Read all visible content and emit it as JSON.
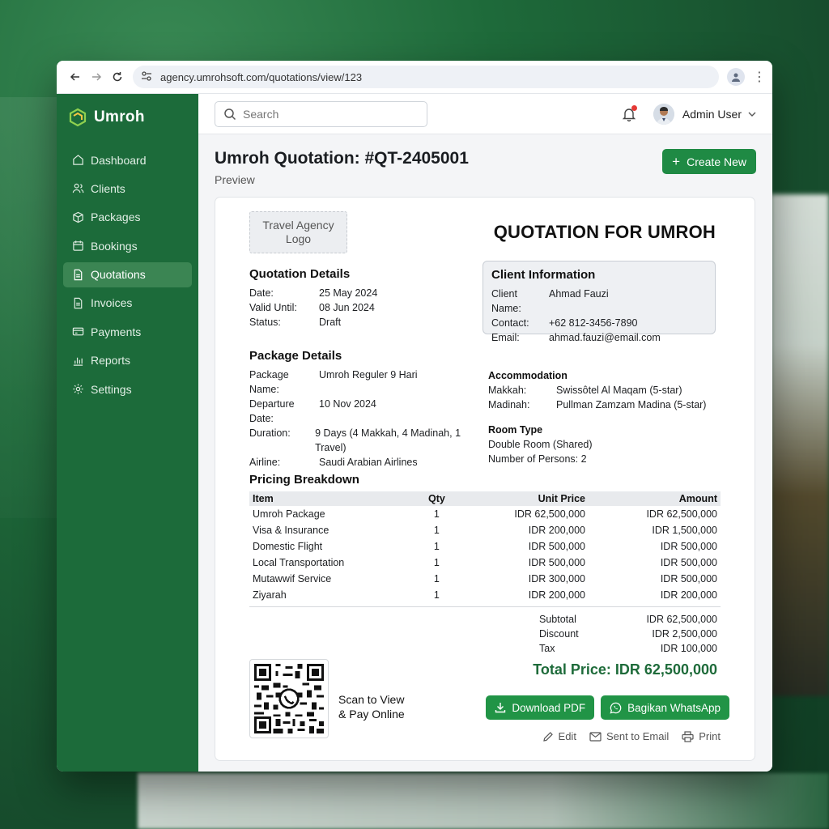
{
  "browser": {
    "url": "agency.umrohsoft.com/quotations/view/123"
  },
  "sidebar": {
    "brand": "Umroh",
    "items": [
      {
        "label": "Dashboard",
        "icon": "home-icon"
      },
      {
        "label": "Clients",
        "icon": "users-icon"
      },
      {
        "label": "Packages",
        "icon": "box-icon"
      },
      {
        "label": "Bookings",
        "icon": "calendar-icon"
      },
      {
        "label": "Quotations",
        "icon": "file-icon",
        "active": true
      },
      {
        "label": "Invoices",
        "icon": "file-icon"
      },
      {
        "label": "Payments",
        "icon": "card-icon"
      },
      {
        "label": "Reports",
        "icon": "chart-icon"
      },
      {
        "label": "Settings",
        "icon": "gear-icon"
      }
    ]
  },
  "topbar": {
    "search_placeholder": "Search",
    "user_name": "Admin User"
  },
  "page": {
    "title": "Umroh Quotation: #QT-2405001",
    "subtitle": "Preview",
    "create_label": "Create New"
  },
  "doc": {
    "logo_placeholder": "Travel Agency Logo",
    "title": "QUOTATION FOR UMROH",
    "quotation_details": {
      "heading": "Quotation Details",
      "date_label": "Date:",
      "date": "25 May 2024",
      "valid_label": "Valid Until:",
      "valid": "08 Jun 2024",
      "status_label": "Status:",
      "status": "Draft"
    },
    "client": {
      "heading": "Client Information",
      "name_label": "Client Name:",
      "name": "Ahmad Fauzi",
      "contact_label": "Contact:",
      "contact": "+62 812-3456-7890",
      "email_label": "Email:",
      "email": "ahmad.fauzi@email.com"
    },
    "package": {
      "heading": "Package Details",
      "name_label": "Package Name:",
      "name": "Umroh Reguler 9 Hari",
      "departure_label": "Departure Date:",
      "departure": "10 Nov 2024",
      "duration_label": "Duration:",
      "duration": "9 Days (4 Makkah, 4 Madinah, 1 Travel)",
      "airline_label": "Airline:",
      "airline": "Saudi Arabian Airlines"
    },
    "accommodation": {
      "heading": "Accommodation",
      "makkah_label": "Makkah:",
      "makkah": "Swissôtel Al Maqam (5-star)",
      "madinah_label": "Madinah:",
      "madinah": "Pullman Zamzam Madina (5-star)"
    },
    "room": {
      "heading": "Room Type",
      "type": "Double Room (Shared)",
      "persons_label": "Number of Persons:",
      "persons": "2"
    },
    "pricing": {
      "heading": "Pricing Breakdown",
      "columns": [
        "Item",
        "Qty",
        "Unit Price",
        "Amount"
      ],
      "rows": [
        [
          "Umroh Package",
          "1",
          "IDR 62,500,000",
          "IDR 62,500,000"
        ],
        [
          "Visa & Insurance",
          "1",
          "IDR 200,000",
          "IDR 1,500,000"
        ],
        [
          "Domestic Flight",
          "1",
          "IDR 500,000",
          "IDR 500,000"
        ],
        [
          "Local Transportation",
          "1",
          "IDR 500,000",
          "IDR 500,000"
        ],
        [
          "Mutawwif Service",
          "1",
          "IDR 300,000",
          "IDR 500,000"
        ],
        [
          "Ziyarah",
          "1",
          "IDR 200,000",
          "IDR 200,000"
        ]
      ],
      "subtotal_label": "Subtotal",
      "subtotal": "IDR 62,500,000",
      "discount_label": "Discount",
      "discount": "IDR 2,500,000",
      "tax_label": "Tax",
      "tax": "IDR 100,000",
      "total": "Total Price: IDR 62,500,000"
    },
    "qr_text_1": "Scan to View",
    "qr_text_2": "& Pay Online",
    "download_label": "Download PDF",
    "whatsapp_label": "Bagikan WhatsApp",
    "edit_label": "Edit",
    "email_label": "Sent to Email",
    "print_label": "Print"
  },
  "colors": {
    "sidebar": "#1c6b3a",
    "accent": "#1f8a44",
    "total": "#1e6b3a",
    "notification": "#e53935"
  }
}
